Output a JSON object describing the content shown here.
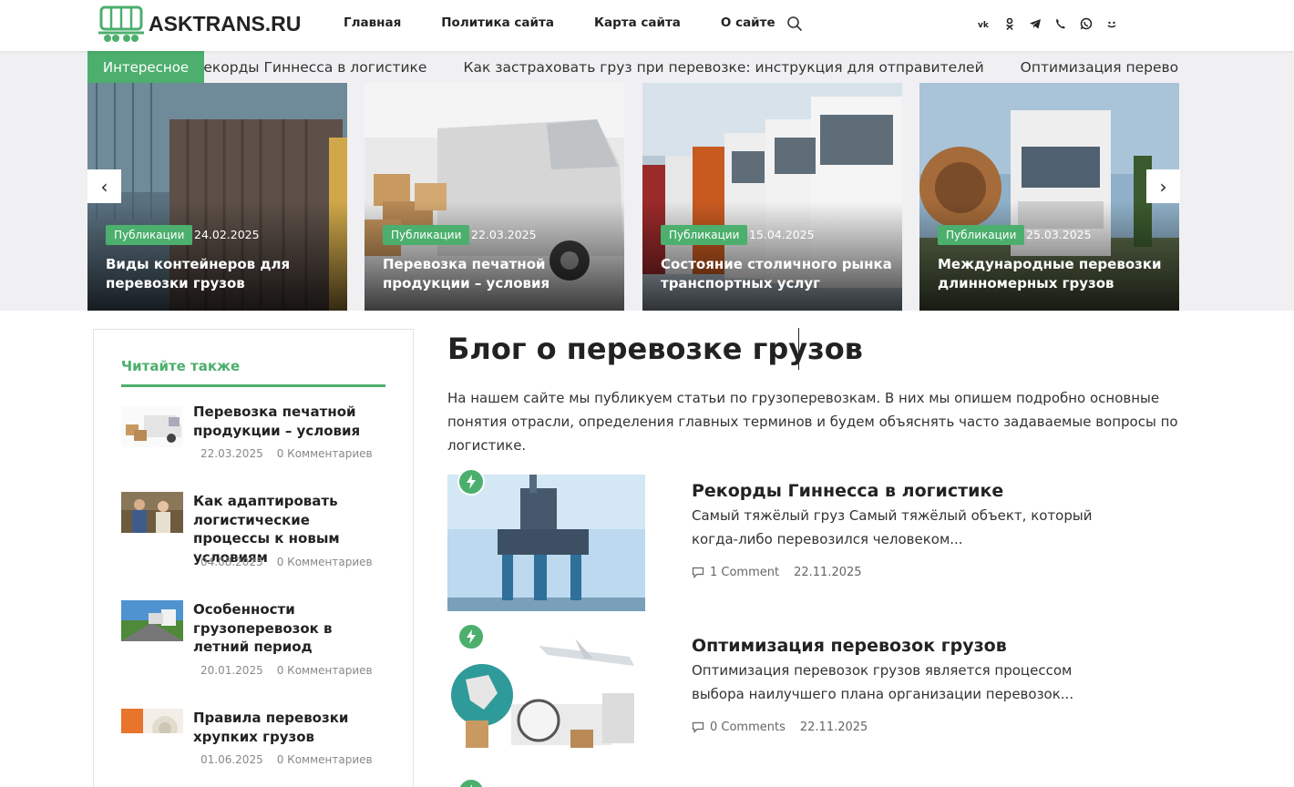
{
  "header": {
    "logo_text": "ASKTRANS.RU",
    "nav": [
      "Главная",
      "Политика сайта",
      "Карта сайта",
      "О сайте"
    ],
    "socials": [
      "vk-icon",
      "odnoklassniki-icon",
      "telegram-icon",
      "viber-icon",
      "whatsapp-icon",
      "mail-ru-icon"
    ]
  },
  "ticker": {
    "tag": "Интересное",
    "items": [
      "Рекорды Гиннесса в логистике",
      "Как застраховать груз при перевозке: инструкция для отправителей",
      "Оптимизация перевозок грузов"
    ]
  },
  "slider": {
    "prev": "‹",
    "next": "›",
    "cards": [
      {
        "category": "Публикации",
        "date": "24.02.2025",
        "title": "Виды контейнеров для перевозки грузов"
      },
      {
        "category": "Публикации",
        "date": "22.03.2025",
        "title": "Перевозка печатной продукции – условия"
      },
      {
        "category": "Публикации",
        "date": "15.04.2025",
        "title": "Состояние столичного рынка транспортных услуг"
      },
      {
        "category": "Публикации",
        "date": "25.03.2025",
        "title": "Международные перевозки длинномерных грузов"
      }
    ]
  },
  "sidebar": {
    "title": "Читайте также",
    "items": [
      {
        "title": "Перевозка печатной продукции – условия",
        "date": "22.03.2025",
        "comments": "0 Комментариев"
      },
      {
        "title": "Как адаптировать логистические процессы к новым условиям",
        "date": "04.08.2025",
        "comments": "0 Комментариев"
      },
      {
        "title": "Особенности грузоперевозок в летний период",
        "date": "20.01.2025",
        "comments": "0 Комментариев"
      },
      {
        "title": "Правила перевозки хрупких грузов",
        "date": "01.06.2025",
        "comments": "0 Комментариев"
      }
    ]
  },
  "main": {
    "title": "Блог о перевозке грузов",
    "description": "На нашем сайте мы публикуем статьи по грузоперевозкам. В них мы опишем подробно основные понятия отрасли, определения главных терминов и будем объяснять часто задаваемые вопросы по логистике.",
    "posts": [
      {
        "title": "Рекорды Гиннесса в логистике",
        "excerpt": "Самый тяжёлый груз Самый тяжёлый объект, который когда-либо перевозился человеком...",
        "comments": "1 Comment",
        "date": "22.11.2025"
      },
      {
        "title": "Оптимизация перевозок грузов",
        "excerpt": "Оптимизация перевозок грузов является процессом выбора наилучшего плана организации перевозок...",
        "comments": "0 Comments",
        "date": "22.11.2025"
      }
    ]
  },
  "colors": {
    "accent": "#4caf6d",
    "text": "#222222"
  }
}
